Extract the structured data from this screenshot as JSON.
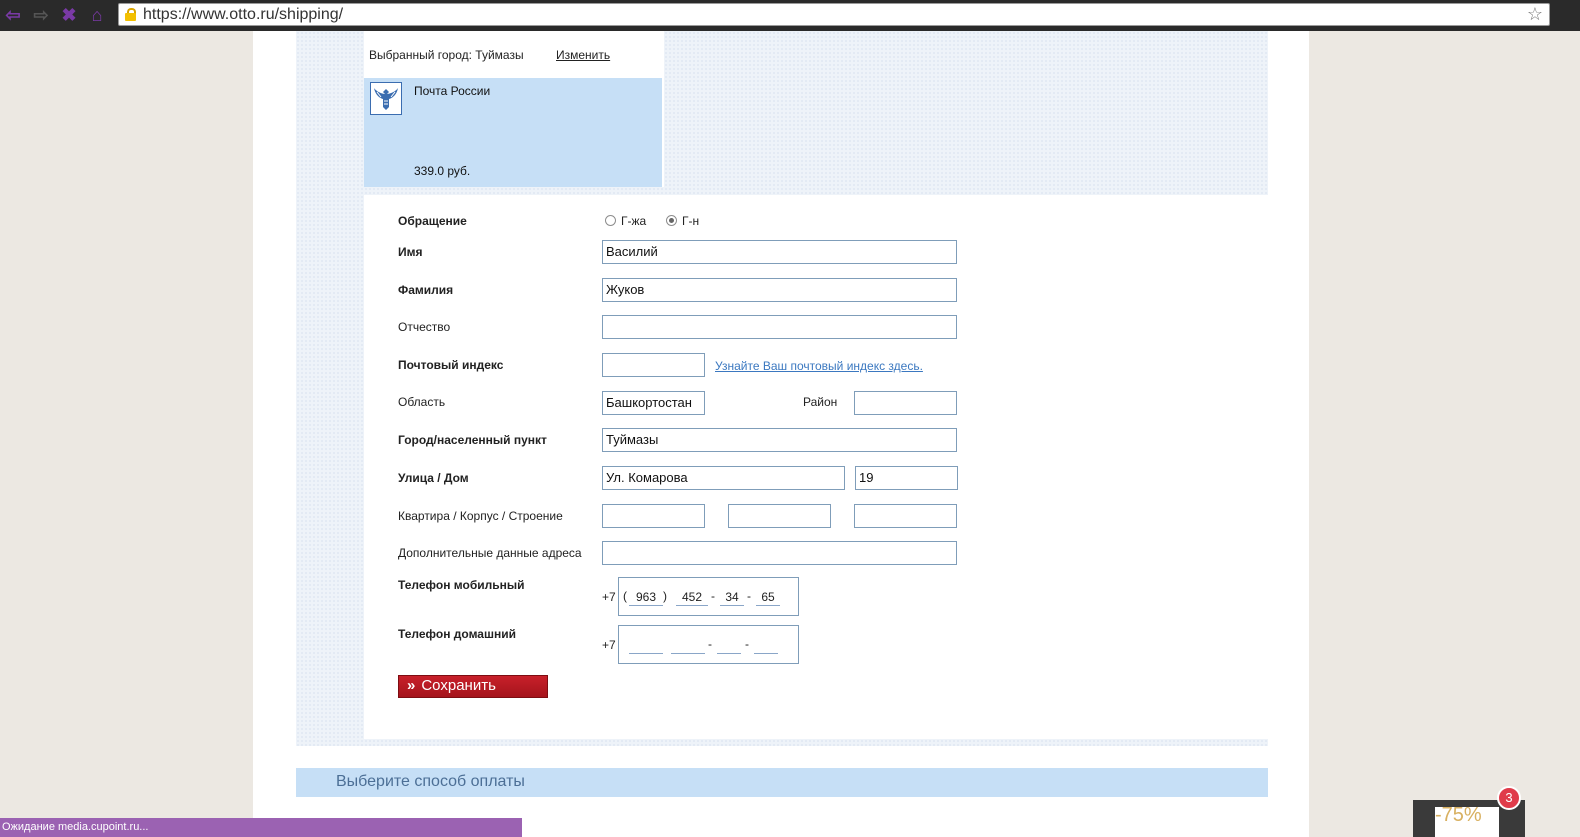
{
  "browser": {
    "url": "https://www.otto.ru/shipping/"
  },
  "shipping": {
    "city_label": "Выбранный город: Туймазы",
    "change_link": "Изменить",
    "carrier_name": "Почта России",
    "carrier_price": "339.0 руб."
  },
  "form": {
    "salutation_label": "Обращение",
    "salutation_options": [
      "Г-жа",
      "Г-н"
    ],
    "salutation_selected": "Г-н",
    "first_name_label": "Имя",
    "first_name_value": "Василий",
    "last_name_label": "Фамилия",
    "last_name_value": "Жуков",
    "patronymic_label": "Отчество",
    "patronymic_value": "",
    "zip_label": "Почтовый индекс",
    "zip_value": "",
    "zip_link": "Узнайте Ваш почтовый индекс здесь.",
    "region_label": "Область",
    "region_value": "Башкортостан",
    "district_label": "Район",
    "district_value": "",
    "city_label": "Город/населенный пункт",
    "city_value": "Туймазы",
    "street_label": "Улица / Дом",
    "street_value": "Ул. Комарова",
    "house_value": "19",
    "apartment_label": "Квартира / Корпус / Строение",
    "apartment_value": "",
    "building_value": "",
    "structure_value": "",
    "additional_label": "Дополнительные данные адреса",
    "additional_value": "",
    "mobile_label": "Телефон мобильный",
    "mobile_prefix": "+7",
    "mobile_code": "963",
    "mobile_part1": "452",
    "mobile_part2": "34",
    "mobile_part3": "65",
    "home_label": "Телефон домашний",
    "home_prefix": "+7",
    "home_code": "",
    "home_part1": "",
    "home_part2": "",
    "home_part3": "",
    "save_label": "Сохранить"
  },
  "payment": {
    "title": "Выберите способ оплаты"
  },
  "statusbar": {
    "text": "Ожидание media.cupoint.ru..."
  },
  "promo": {
    "discount": "-75%",
    "badge_count": "3"
  }
}
